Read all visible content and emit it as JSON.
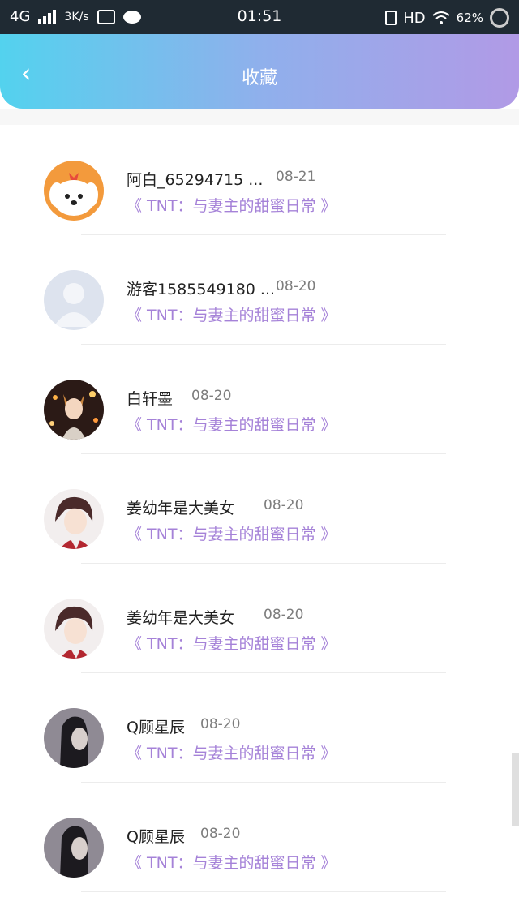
{
  "status_bar": {
    "network": "4G",
    "speed": "3K/s",
    "time": "01:51",
    "hd": "HD",
    "battery": "62%"
  },
  "header": {
    "back_symbol": "‹",
    "title": "收藏"
  },
  "favorites": [
    {
      "name": "阿白_65294715 ...",
      "date": "08-21",
      "book": "《 TNT：与妻主的甜蜜日常 》",
      "avatar": "cartoon-dog-avatar"
    },
    {
      "name": "游客1585549180 ...",
      "date": "08-20",
      "book": "《 TNT：与妻主的甜蜜日常 》",
      "avatar": "default-user-avatar"
    },
    {
      "name": "白轩墨",
      "date": "08-20",
      "book": "《 TNT：与妻主的甜蜜日常 》",
      "avatar": "fox-girl-avatar"
    },
    {
      "name": "姜幼年是大美女",
      "date": "08-20",
      "book": "《 TNT：与妻主的甜蜜日常 》",
      "avatar": "anime-girl-avatar"
    },
    {
      "name": "姜幼年是大美女",
      "date": "08-20",
      "book": "《 TNT：与妻主的甜蜜日常 》",
      "avatar": "anime-girl-avatar"
    },
    {
      "name": "Q顾星辰",
      "date": "08-20",
      "book": "《 TNT：与妻主的甜蜜日常 》",
      "avatar": "dark-portrait-avatar"
    },
    {
      "name": "Q顾星辰",
      "date": "08-20",
      "book": "《 TNT：与妻主的甜蜜日常 》",
      "avatar": "dark-portrait-avatar"
    }
  ],
  "colors": {
    "header_gradient_start": "#53d2ee",
    "header_gradient_end": "#b19ae6",
    "book_title": "#a582d8",
    "date": "#7d7d7d"
  }
}
